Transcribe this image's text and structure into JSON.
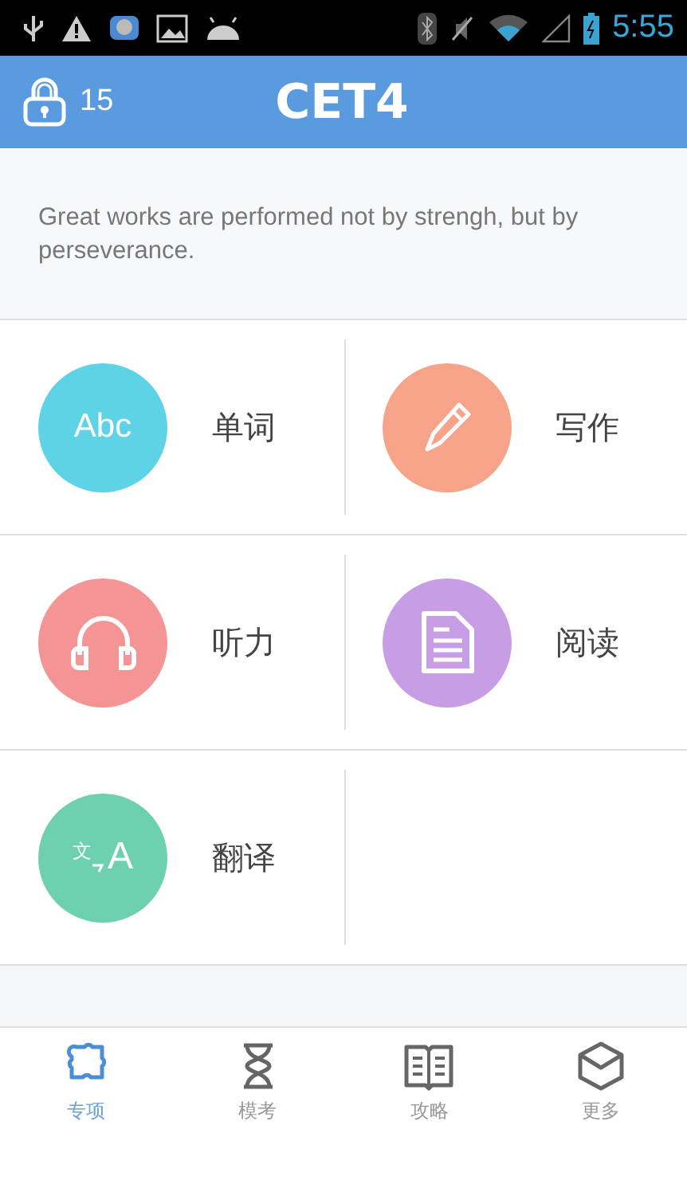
{
  "status_bar": {
    "time": "5:55"
  },
  "header": {
    "lock_count": "15",
    "title": "CET4"
  },
  "quote": "Great works are performed not by strengh, but by perseverance.",
  "tiles": [
    {
      "label": "单词",
      "color": "#5fd3e6",
      "kind": "text",
      "icon_text": "Abc"
    },
    {
      "label": "写作",
      "color": "#f6a38a",
      "kind": "pen"
    },
    {
      "label": "听力",
      "color": "#f49494",
      "kind": "headphones"
    },
    {
      "label": "阅读",
      "color": "#c79ee6",
      "kind": "document"
    },
    {
      "label": "翻译",
      "color": "#6dd1b0",
      "kind": "translate",
      "icon_text": "文",
      "icon_text_2": "A"
    }
  ],
  "tabs": [
    {
      "label": "专项",
      "kind": "puzzle",
      "selected": true
    },
    {
      "label": "模考",
      "kind": "hourglass",
      "selected": false
    },
    {
      "label": "攻略",
      "kind": "book",
      "selected": false
    },
    {
      "label": "更多",
      "kind": "cube",
      "selected": false
    }
  ]
}
